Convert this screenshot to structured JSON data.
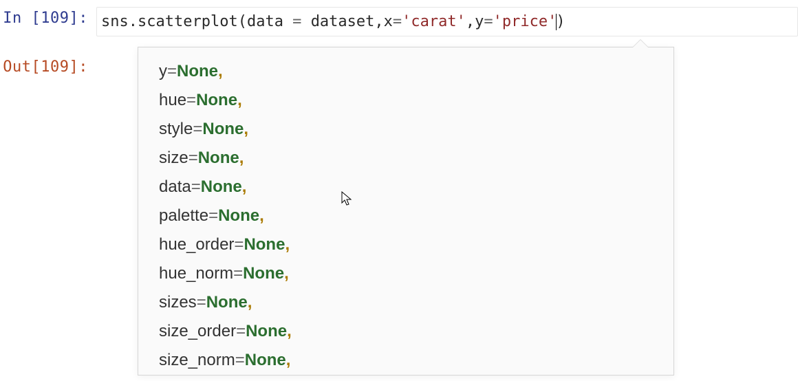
{
  "in_prompt": {
    "label": "In ",
    "open": "[",
    "num": "109",
    "close": "]:"
  },
  "out_prompt": {
    "label": "Out",
    "open": "[",
    "num": "109",
    "close": "]:"
  },
  "code": {
    "obj": "sns",
    "dot": ".",
    "fn": "scatterplot",
    "lparen": "(",
    "p1": "data",
    "eq1": " = ",
    "v1": "dataset",
    "comma1": ",",
    "p2": "x",
    "eq2": "=",
    "v2": "'carat'",
    "comma2": ",",
    "p3": "y",
    "eq3": "=",
    "v3": "'price'",
    "rparen": ")"
  },
  "tooltip": {
    "params": [
      {
        "name": "y",
        "value": "None"
      },
      {
        "name": "hue",
        "value": "None"
      },
      {
        "name": "style",
        "value": "None"
      },
      {
        "name": "size",
        "value": "None"
      },
      {
        "name": "data",
        "value": "None"
      },
      {
        "name": "palette",
        "value": "None"
      },
      {
        "name": "hue_order",
        "value": "None"
      },
      {
        "name": "hue_norm",
        "value": "None"
      },
      {
        "name": "sizes",
        "value": "None"
      },
      {
        "name": "size_order",
        "value": "None"
      },
      {
        "name": "size_norm",
        "value": "None"
      }
    ],
    "eq": "=",
    "comma": ","
  }
}
